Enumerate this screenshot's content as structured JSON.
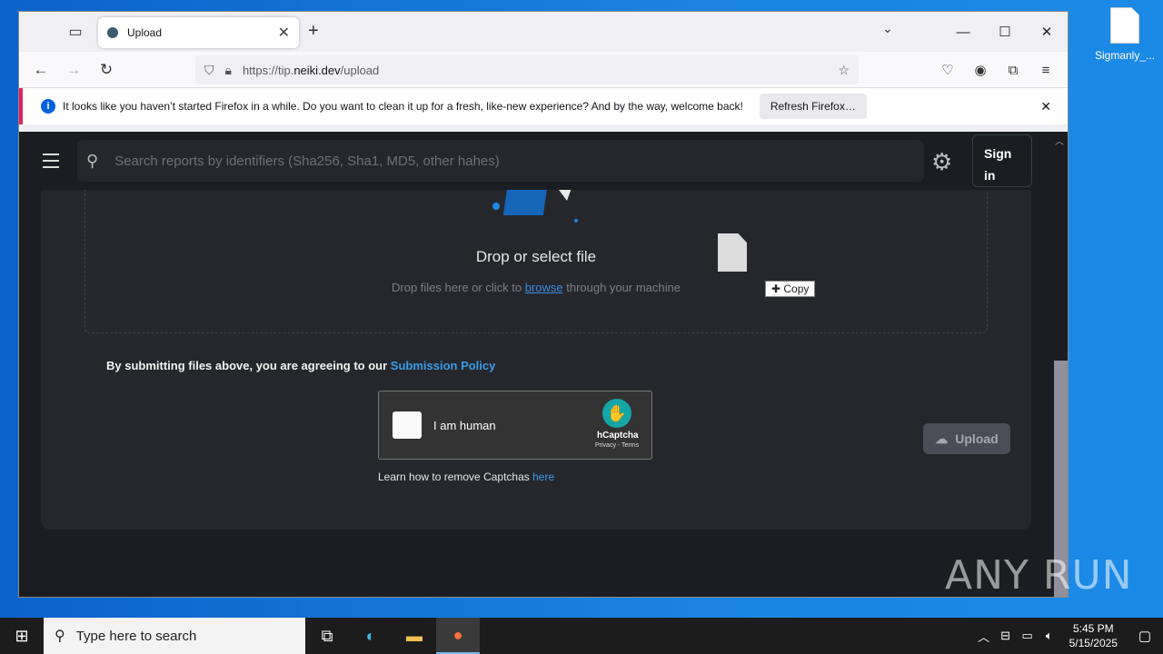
{
  "desktop": {
    "file_icon_label": "Sigmanly_..."
  },
  "browser": {
    "tab_title": "Upload",
    "url_prefix": "https://tip.",
    "url_domain": "neiki.dev",
    "url_path": "/upload",
    "notice_text": "It looks like you haven’t started Firefox in a while. Do you want to clean it up for a fresh, like-new experience? And by the way, welcome back!",
    "refresh_label": "Refresh Firefox…"
  },
  "page": {
    "search_placeholder": "Search reports by identifiers (Sha256, Sha1, MD5, other hahes)",
    "signin_label": "Sign in",
    "drop_title": "Drop or select file",
    "drop_sub_before": "Drop files here or click to ",
    "drop_sub_link": "browse",
    "drop_sub_after": " through your machine",
    "copy_tooltip": "Copy",
    "policy_text": "By submitting files above, you are agreeing to our ",
    "policy_link": "Submission Policy",
    "captcha_label": "I am human",
    "captcha_brand": "hCaptcha",
    "captcha_terms": "Privacy - Terms",
    "learn_text": "Learn how to remove Captchas ",
    "learn_link": "here",
    "upload_label": "Upload"
  },
  "watermark": "ANY RUN",
  "taskbar": {
    "search_placeholder": "Type here to search",
    "time": "5:45 PM",
    "date": "5/15/2025"
  },
  "colors": {
    "page_bg": "#1b1d22",
    "card_bg": "#25272d",
    "link": "#3a9ce8",
    "captcha_accent": "#14a6a6"
  }
}
